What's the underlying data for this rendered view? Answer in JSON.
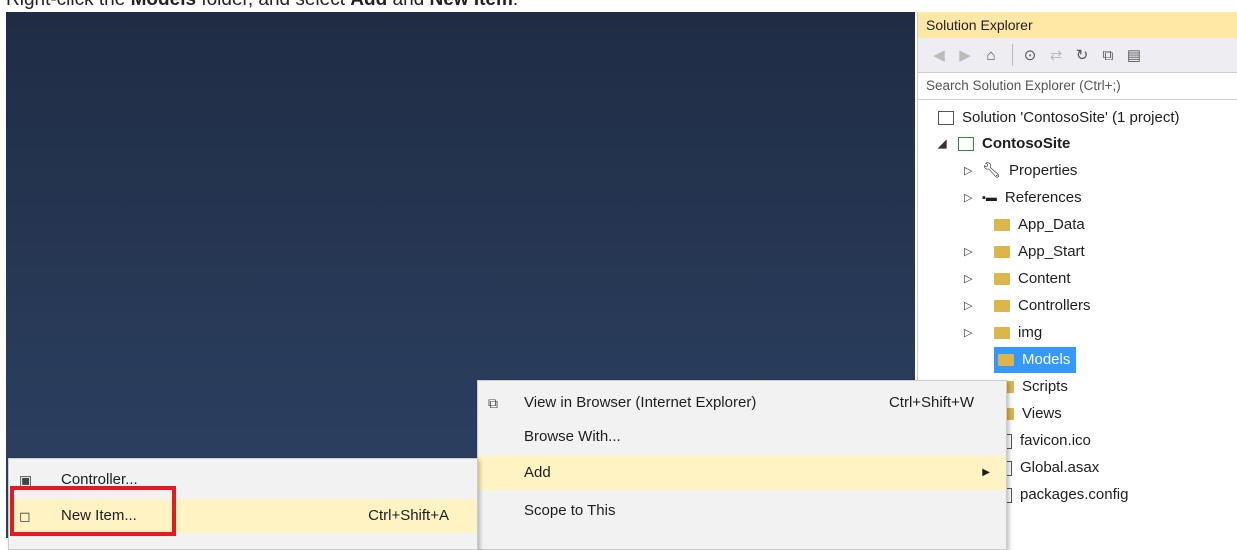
{
  "instruction": {
    "part1": "Right-click the ",
    "bold1": "Models",
    "part2": " folder, and select ",
    "bold2": "Add",
    "part3": " and ",
    "bold3": "New Item",
    "part4": "."
  },
  "solution_explorer": {
    "title": "Solution Explorer",
    "search_placeholder": "Search Solution Explorer (Ctrl+;)",
    "toolbar_icons": [
      "back-icon",
      "forward-icon",
      "home-icon",
      "history-icon",
      "sync-icon",
      "refresh-icon",
      "collapse-all-icon",
      "show-all-files-icon"
    ],
    "tree": {
      "solution": "Solution 'ContosoSite' (1 project)",
      "project": "ContosoSite",
      "properties": "Properties",
      "references": "References",
      "app_data": "App_Data",
      "app_start": "App_Start",
      "content": "Content",
      "controllers": "Controllers",
      "img": "img",
      "models": "Models",
      "scripts": "Scripts",
      "views": "Views",
      "favicon": "favicon.ico",
      "global": "Global.asax",
      "packages": "packages.config"
    }
  },
  "context_menu": {
    "view_in_browser": "View in Browser (Internet Explorer)",
    "view_in_browser_shortcut": "Ctrl+Shift+W",
    "browse_with": "Browse With...",
    "add": "Add",
    "scope_to_this": "Scope to This"
  },
  "add_submenu": {
    "controller": "Controller...",
    "new_item": "New Item...",
    "new_item_shortcut": "Ctrl+Shift+A"
  },
  "colors": {
    "highlight": "#fff3c4",
    "selection": "#3399ff",
    "annotation": "#e01b24"
  }
}
